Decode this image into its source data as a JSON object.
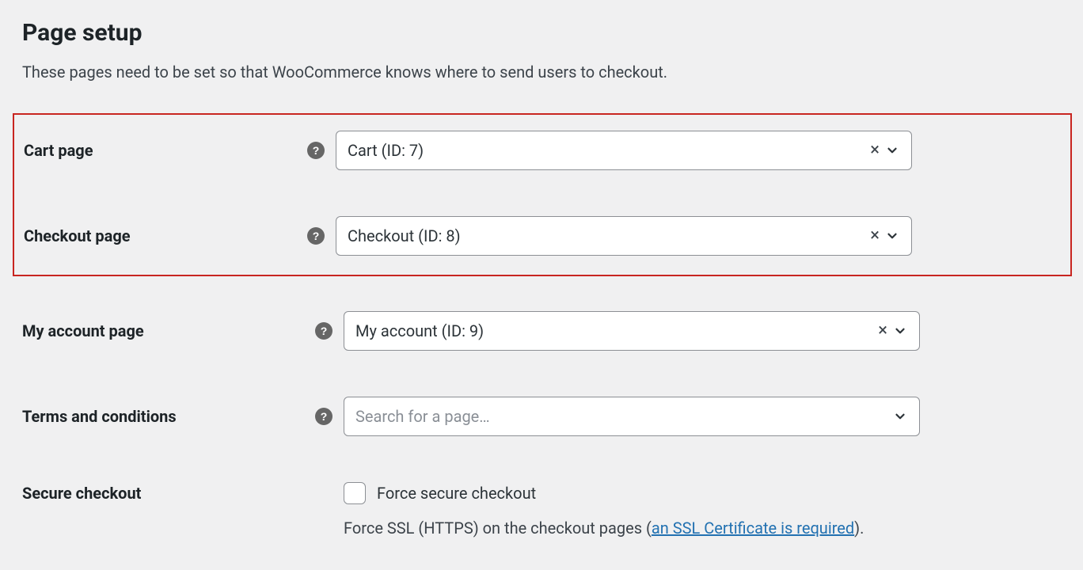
{
  "heading": "Page setup",
  "description": "These pages need to be set so that WooCommerce knows where to send users to checkout.",
  "rows": {
    "cart": {
      "label": "Cart page",
      "value": "Cart (ID: 7)"
    },
    "checkout": {
      "label": "Checkout page",
      "value": "Checkout (ID: 8)"
    },
    "my_account": {
      "label": "My account page",
      "value": "My account (ID: 9)"
    },
    "terms": {
      "label": "Terms and conditions",
      "placeholder": "Search for a page…"
    },
    "secure_checkout": {
      "label": "Secure checkout",
      "checkbox_label": "Force secure checkout",
      "desc_prefix": "Force SSL (HTTPS) on the checkout pages (",
      "link_text": "an SSL Certificate is required",
      "desc_suffix": ")."
    }
  },
  "icons": {
    "help": "?",
    "clear": "×"
  }
}
